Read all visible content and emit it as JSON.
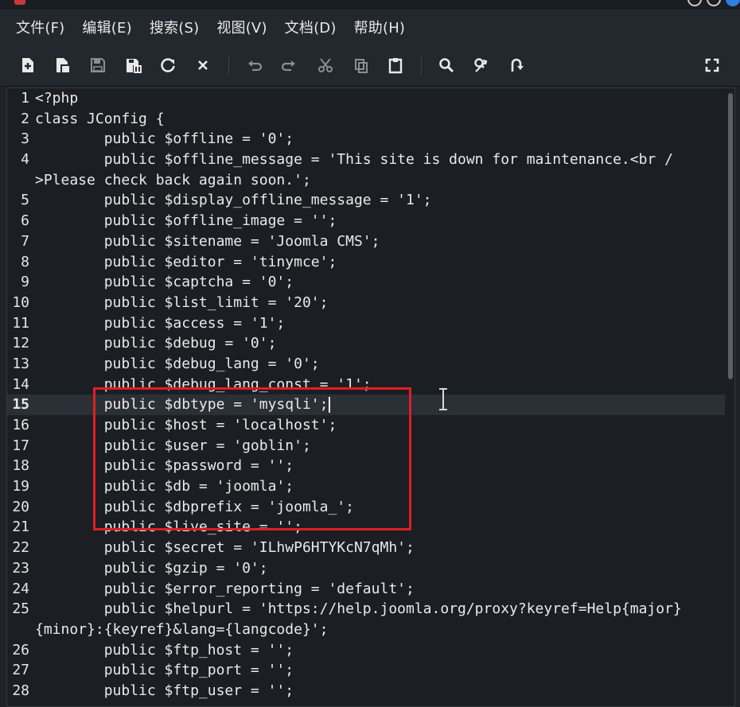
{
  "menubar": {
    "items": [
      "文件(F)",
      "编辑(E)",
      "搜索(S)",
      "视图(V)",
      "文档(D)",
      "帮助(H)"
    ]
  },
  "toolbar": {
    "buttons": [
      {
        "icon": "new-file-icon"
      },
      {
        "icon": "open-file-icon"
      },
      {
        "icon": "save-icon"
      },
      {
        "icon": "save-as-icon"
      },
      {
        "icon": "reload-icon"
      },
      {
        "icon": "close-icon"
      },
      {
        "icon": "undo-icon"
      },
      {
        "icon": "redo-icon"
      },
      {
        "icon": "cut-icon"
      },
      {
        "icon": "copy-icon"
      },
      {
        "icon": "paste-icon"
      },
      {
        "icon": "search-icon"
      },
      {
        "icon": "replace-icon"
      },
      {
        "icon": "goto-icon"
      },
      {
        "icon": "fullscreen-icon"
      }
    ]
  },
  "editor": {
    "current_line": 15,
    "lines": [
      {
        "n": "1",
        "text": "<?php"
      },
      {
        "n": "2",
        "text": "class JConfig {"
      },
      {
        "n": "3",
        "text": "        public $offline = '0';"
      },
      {
        "n": "4",
        "text": "        public $offline_message = 'This site is down for maintenance.<br /"
      },
      {
        "n": "",
        "text": ">Please check back again soon.';"
      },
      {
        "n": "5",
        "text": "        public $display_offline_message = '1';"
      },
      {
        "n": "6",
        "text": "        public $offline_image = '';"
      },
      {
        "n": "7",
        "text": "        public $sitename = 'Joomla CMS';"
      },
      {
        "n": "8",
        "text": "        public $editor = 'tinymce';"
      },
      {
        "n": "9",
        "text": "        public $captcha = '0';"
      },
      {
        "n": "10",
        "text": "        public $list_limit = '20';"
      },
      {
        "n": "11",
        "text": "        public $access = '1';"
      },
      {
        "n": "12",
        "text": "        public $debug = '0';"
      },
      {
        "n": "13",
        "text": "        public $debug_lang = '0';"
      },
      {
        "n": "14",
        "text": "        public $debug_lang_const = '1';"
      },
      {
        "n": "15",
        "text": "        public $dbtype = 'mysqli';"
      },
      {
        "n": "16",
        "text": "        public $host = 'localhost';"
      },
      {
        "n": "17",
        "text": "        public $user = 'goblin';"
      },
      {
        "n": "18",
        "text": "        public $password = '';"
      },
      {
        "n": "19",
        "text": "        public $db = 'joomla';"
      },
      {
        "n": "20",
        "text": "        public $dbprefix = 'joomla_';"
      },
      {
        "n": "21",
        "text": "        public $live_site = '';"
      },
      {
        "n": "22",
        "text": "        public $secret = 'ILhwP6HTYKcN7qMh';"
      },
      {
        "n": "23",
        "text": "        public $gzip = '0';"
      },
      {
        "n": "24",
        "text": "        public $error_reporting = 'default';"
      },
      {
        "n": "25",
        "text": "        public $helpurl = 'https://help.joomla.org/proxy?keyref=Help{major}"
      },
      {
        "n": "",
        "text": "{minor}:{keyref}&lang={langcode}';"
      },
      {
        "n": "26",
        "text": "        public $ftp_host = '';"
      },
      {
        "n": "27",
        "text": "        public $ftp_port = '';"
      },
      {
        "n": "28",
        "text": "        public $ftp_user = '';"
      }
    ]
  },
  "colors": {
    "background": "#1b1e23",
    "current_line": "#2b2f36",
    "annotation_box": "#e01e24"
  }
}
